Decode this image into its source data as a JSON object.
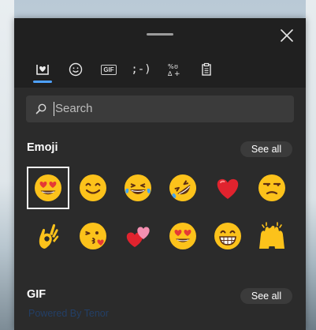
{
  "panel": {
    "tabs": [
      {
        "name": "tab-emoji",
        "icon": "heart-emoji-icon",
        "active": true
      },
      {
        "name": "tab-smiley",
        "icon": "smiley-icon",
        "active": false
      },
      {
        "name": "tab-gif",
        "icon": "gif-icon",
        "label": "GIF",
        "active": false
      },
      {
        "name": "tab-kaomoji",
        "icon": "kaomoji-icon",
        "label": ";-)",
        "active": false
      },
      {
        "name": "tab-symbols",
        "icon": "symbols-icon",
        "label": "%ʊ∆+",
        "active": false
      },
      {
        "name": "tab-clipboard",
        "icon": "clipboard-icon",
        "active": false
      }
    ],
    "accent_color": "#4ea1ff"
  },
  "search": {
    "placeholder": "Search",
    "value": ""
  },
  "emoji_section": {
    "title": "Emoji",
    "see_all_label": "See all",
    "items": [
      {
        "name": "heart-eyes-emoji",
        "char": "😍",
        "selected": true
      },
      {
        "name": "smiling-emoji",
        "char": "😊"
      },
      {
        "name": "tears-of-joy-emoji",
        "char": "😂"
      },
      {
        "name": "rolling-on-floor-laughing-emoji",
        "char": "🤣"
      },
      {
        "name": "red-heart-emoji",
        "char": "❤️"
      },
      {
        "name": "unamused-emoji",
        "char": "😒"
      },
      {
        "name": "ok-hand-emoji",
        "char": "👌"
      },
      {
        "name": "kissing-heart-emoji",
        "char": "😘"
      },
      {
        "name": "two-hearts-emoji",
        "char": "💕"
      },
      {
        "name": "heart-eyes-smiling-emoji",
        "char": "😍"
      },
      {
        "name": "grinning-emoji",
        "char": "😁"
      },
      {
        "name": "thumbs-up-emoji",
        "char": "👍"
      },
      {
        "name": "raising-hands-emoji",
        "char": "🙌"
      }
    ]
  },
  "gif_section": {
    "title": "GIF",
    "see_all_label": "See all",
    "powered_by": "Powered By Tenor"
  }
}
